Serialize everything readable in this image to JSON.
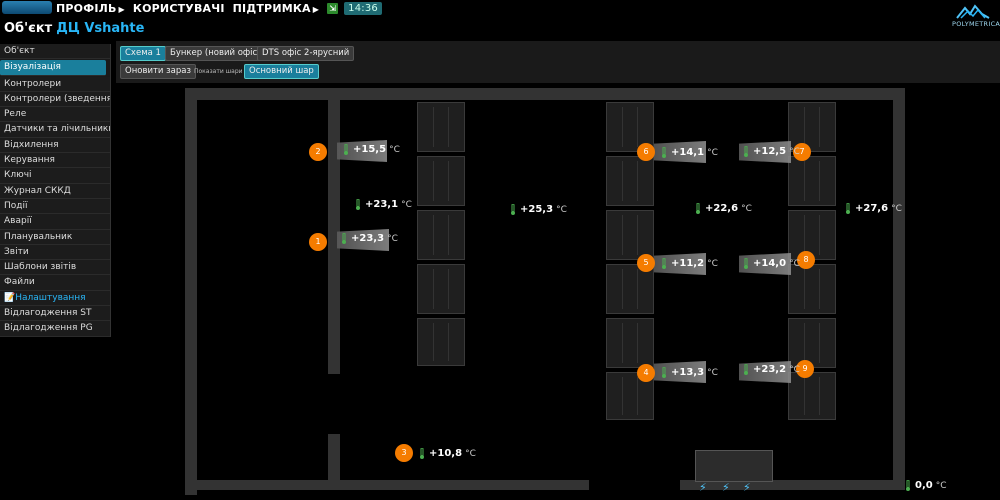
{
  "topbar": {
    "menu": [
      {
        "label": "ПРОФІЛЬ",
        "arrow": "▶"
      },
      {
        "label": "КОРИСТУВАЧІ",
        "arrow": ""
      },
      {
        "label": "ПІДТРИМКА",
        "arrow": "▶"
      }
    ],
    "time": "14:36"
  },
  "object": {
    "prefix": "Об'єкт",
    "name": "ДЦ Vshahte"
  },
  "brand": {
    "name": "POLYMETRICA"
  },
  "sidebar": {
    "items": [
      {
        "label": "Об'єкт"
      },
      {
        "label": "Візуалізація"
      },
      {
        "label": "Контролери"
      },
      {
        "label": "Контролери (зведення)"
      },
      {
        "label": "Реле"
      },
      {
        "label": "Датчики та лічильники"
      },
      {
        "label": "Відхилення"
      },
      {
        "label": "Керування"
      },
      {
        "label": "Ключі"
      },
      {
        "label": "Журнал СККД"
      },
      {
        "label": "Події"
      },
      {
        "label": "Аварії"
      },
      {
        "label": "Планувальник"
      },
      {
        "label": "Звіти"
      },
      {
        "label": "Шаблони звітів"
      },
      {
        "label": "Файли"
      },
      {
        "label": "Налаштування"
      },
      {
        "label": "Відлагодження ST"
      },
      {
        "label": "Відлагодження PG"
      }
    ]
  },
  "schemes": {
    "tabs": [
      {
        "label": "Схема 1"
      },
      {
        "label": "Бункер (новий офіс)"
      },
      {
        "label": "DTS офіс 2-ярусний"
      }
    ],
    "refresh": "Оновити зараз",
    "layers_label": "Показати шари",
    "base_layer": "Основний шар"
  },
  "sensors": {
    "s1": {
      "badge": "1",
      "value": "+23,3",
      "unit": "°C"
    },
    "s2": {
      "badge": "2",
      "value": "+15,5",
      "unit": "°C"
    },
    "s3": {
      "badge": "3",
      "value": "+10,8",
      "unit": "°C"
    },
    "s4": {
      "badge": "4",
      "value": "+13,3",
      "unit": "°C"
    },
    "s5": {
      "badge": "5",
      "value": "+11,2",
      "unit": "°C"
    },
    "s6": {
      "badge": "6",
      "value": "+14,1",
      "unit": "°C"
    },
    "s7": {
      "badge": "7",
      "value": "+12,5",
      "unit": "°C"
    },
    "s8": {
      "badge": "8",
      "value": "+14,0",
      "unit": "°C"
    },
    "s9": {
      "badge": "9",
      "value": "+23,2",
      "unit": "°C"
    },
    "a1": {
      "value": "+23,1",
      "unit": "°C"
    },
    "a2": {
      "value": "+25,3",
      "unit": "°C"
    },
    "a3": {
      "value": "+22,6",
      "unit": "°C"
    },
    "a4": {
      "value": "+27,6",
      "unit": "°C"
    },
    "a5": {
      "value": "0,0",
      "unit": "°C"
    }
  },
  "colors": {
    "accent": "#1a7f9c",
    "badge": "#f57c00",
    "thermo": "#4caf50",
    "link": "#29b6f6"
  }
}
